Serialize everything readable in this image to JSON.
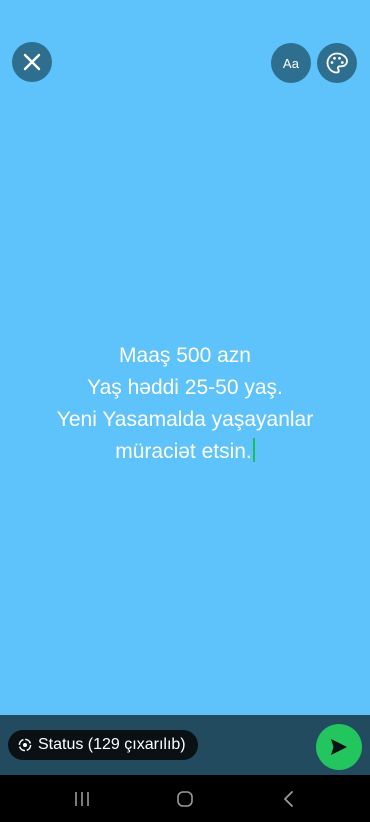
{
  "toolbar": {
    "close_icon": "close-icon",
    "font_label": "Aa",
    "palette_icon": "palette-icon"
  },
  "status_text": {
    "lines": [
      "Maaş 500 azn",
      "Yaş həddi 25-50 yaş.",
      "Yeni Yasamalda yaşayanlar",
      "müraciət etsin."
    ]
  },
  "composer": {
    "audience_label": "Status (129 çıxarılıb)",
    "audience_icon": "status-icon",
    "send_icon": "send-icon"
  },
  "nav": {
    "recents_icon": "recents-icon",
    "home_icon": "home-icon",
    "back_icon": "back-icon"
  },
  "colors": {
    "background": "#5ec3fb",
    "button_bg": "#2e6e8f",
    "bottom_bar": "#234b5f",
    "send_button": "#22c55e",
    "cursor": "#18c05a"
  }
}
